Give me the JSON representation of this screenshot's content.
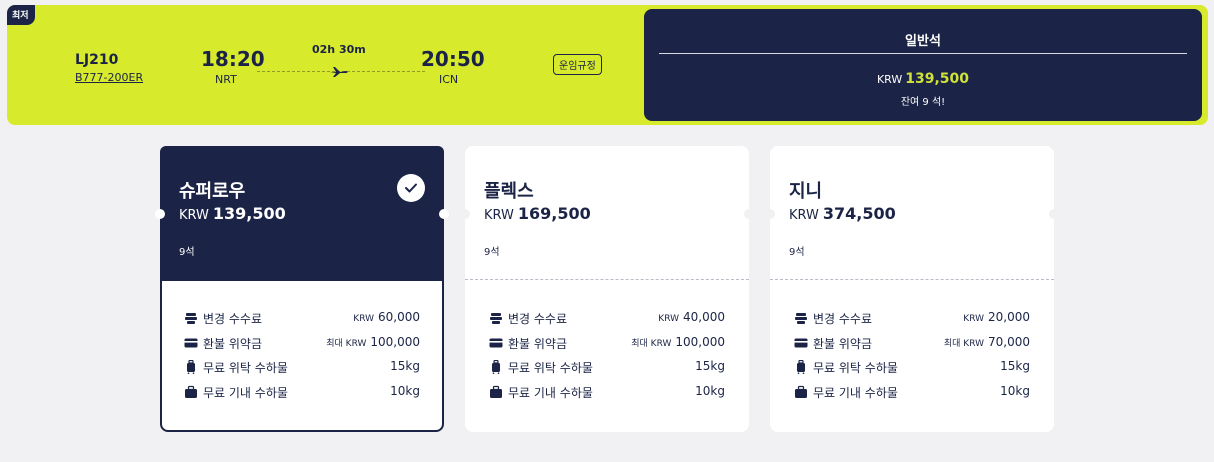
{
  "flight": {
    "badge": "최저",
    "flight_no": "LJ210",
    "aircraft": "B777-200ER",
    "dep_time": "18:20",
    "dep_airport": "NRT",
    "arr_time": "20:50",
    "arr_airport": "ICN",
    "duration": "02h 30m",
    "fare_rule_label": "운임규정"
  },
  "cabin": {
    "title": "일반석",
    "currency": "KRW",
    "price": "139,500",
    "seats_left": "잔여 9 석!"
  },
  "fares": [
    {
      "name": "슈퍼로우",
      "currency": "KRW",
      "price": "139,500",
      "seats": "9석",
      "selected": true,
      "rows": [
        {
          "icon": "ticket-icon",
          "label": "변경 수수료",
          "prefix": "KRW",
          "value": "60,000"
        },
        {
          "icon": "card-icon",
          "label": "환불 위약금",
          "prefix": "최대 KRW",
          "value": "100,000"
        },
        {
          "icon": "suitcase-icon",
          "label": "무료 위탁 수하물",
          "prefix": "",
          "value": "15kg"
        },
        {
          "icon": "bag-icon",
          "label": "무료 기내 수하물",
          "prefix": "",
          "value": "10kg"
        }
      ]
    },
    {
      "name": "플렉스",
      "currency": "KRW",
      "price": "169,500",
      "seats": "9석",
      "selected": false,
      "rows": [
        {
          "icon": "ticket-icon",
          "label": "변경 수수료",
          "prefix": "KRW",
          "value": "40,000"
        },
        {
          "icon": "card-icon",
          "label": "환불 위약금",
          "prefix": "최대 KRW",
          "value": "100,000"
        },
        {
          "icon": "suitcase-icon",
          "label": "무료 위탁 수하물",
          "prefix": "",
          "value": "15kg"
        },
        {
          "icon": "bag-icon",
          "label": "무료 기내 수하물",
          "prefix": "",
          "value": "10kg"
        }
      ]
    },
    {
      "name": "지니",
      "currency": "KRW",
      "price": "374,500",
      "seats": "9석",
      "selected": false,
      "rows": [
        {
          "icon": "ticket-icon",
          "label": "변경 수수료",
          "prefix": "KRW",
          "value": "20,000"
        },
        {
          "icon": "card-icon",
          "label": "환불 위약금",
          "prefix": "최대 KRW",
          "value": "70,000"
        },
        {
          "icon": "suitcase-icon",
          "label": "무료 위탁 수하물",
          "prefix": "",
          "value": "15kg"
        },
        {
          "icon": "bag-icon",
          "label": "무료 기내 수하물",
          "prefix": "",
          "value": "10kg"
        }
      ]
    }
  ],
  "colors": {
    "brand_lime": "#d7ea2b",
    "navy": "#1b2446",
    "price_accent": "#cfe23a"
  }
}
